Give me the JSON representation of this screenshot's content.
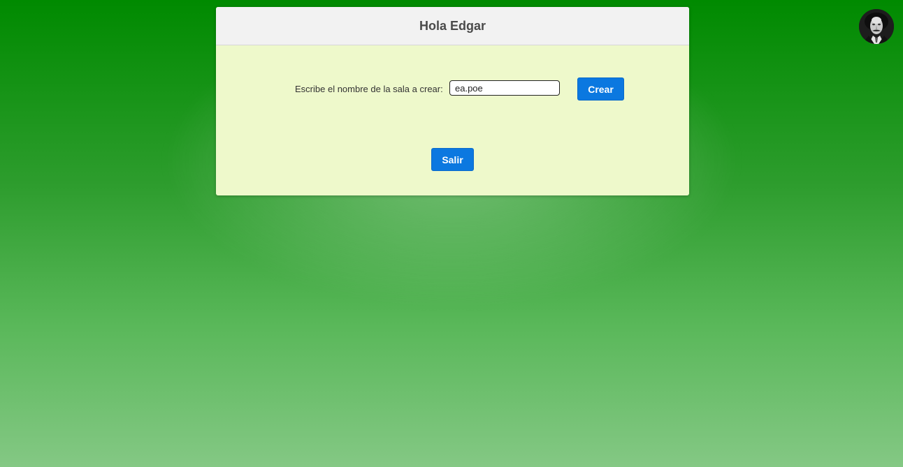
{
  "header": {
    "title": "Hola Edgar"
  },
  "form": {
    "label": "Escribe el nombre de la sala a crear:",
    "room_name_value": "ea.poe",
    "create_label": "Crear"
  },
  "actions": {
    "exit_label": "Salir"
  },
  "user": {
    "avatar_icon": "user-portrait-icon"
  },
  "colors": {
    "button": "#0b78e0",
    "card_body": "#eef9cb",
    "card_header": "#f2f2f2",
    "background_top": "#008a00",
    "background_bottom": "#84c884"
  }
}
